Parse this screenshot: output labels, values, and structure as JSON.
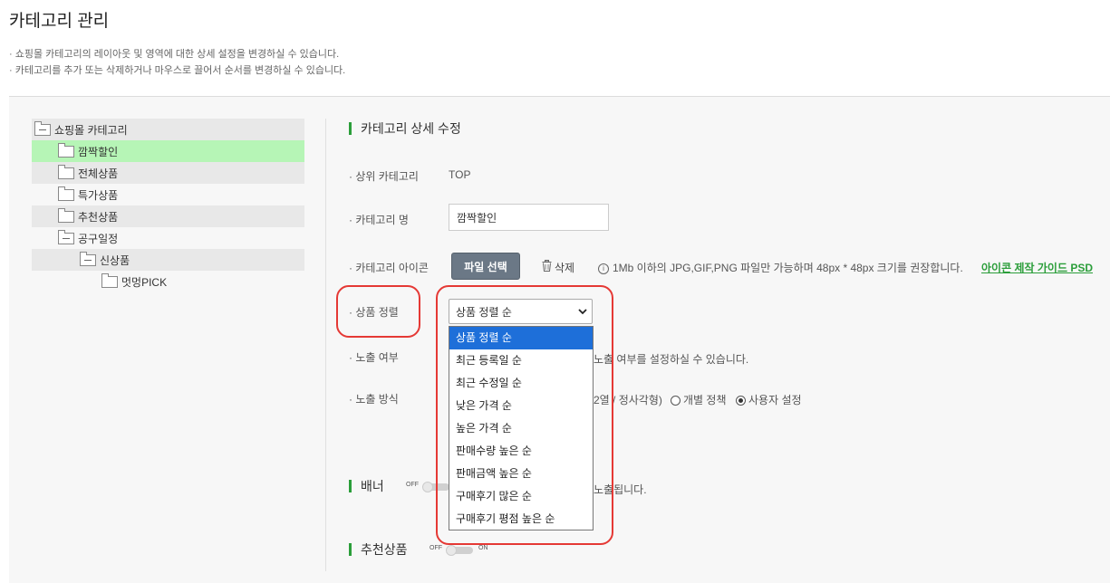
{
  "page": {
    "title": "카테고리 관리",
    "desc1": "· 쇼핑몰 카테고리의 레이아웃 및 영역에 대한 상세 설정을 변경하실 수 있습니다.",
    "desc2": "· 카테고리를 추가 또는 삭제하거나 마우스로 끌어서 순서를 변경하실 수 있습니다."
  },
  "tree": {
    "root": "쇼핑몰 카테고리",
    "items": [
      "깜짝할인",
      "전체상품",
      "특가상품",
      "추천상품",
      "공구일정",
      "신상품",
      "멋멍PICK"
    ]
  },
  "detail": {
    "title": "카테고리 상세 수정",
    "parent_label": "· 상위 카테고리",
    "parent_value": "TOP",
    "name_label": "· 카테고리 명",
    "name_value": "깜짝할인",
    "icon_label": "· 카테고리 아이콘",
    "file_button": "파일 선택",
    "delete_label": "삭제",
    "icon_info": "1Mb 이하의 JPG,GIF,PNG 파일만 가능하며 48px * 48px 크기를 권장합니다.",
    "guide_link": "아이콘 제작 가이드 PSD",
    "sort_label": "· 상품 정렬",
    "sort_selected": "상품 정렬 순",
    "sort_options": [
      "상품 정렬 순",
      "최근 등록일 순",
      "최근 수정일 순",
      "낮은 가격 순",
      "높은 가격 순",
      "판매수량 높은 순",
      "판매금액 높은 순",
      "구매후기 많은 순",
      "구매후기 평점 높은 순"
    ],
    "expose_label": "· 노출 여부",
    "expose_hint_partial": "노출 여부를 설정하실 수 있습니다.",
    "display_label": "· 노출 방식",
    "display_partial": "2열 / 정사각형)",
    "radio_individual": "개별 정책",
    "radio_user": "사용자 설정"
  },
  "banner": {
    "title": "배너",
    "toggle_off": "OFF",
    "hint_partial": "노출됩니다."
  },
  "recommend": {
    "title": "추천상품",
    "toggle_off": "OFF",
    "toggle_on": "ON"
  },
  "colors": {
    "accent_green": "#2b9e3a",
    "highlight_red": "#e53935",
    "selected_option": "#1e6fd9",
    "tree_selected": "#b6f5b6"
  }
}
